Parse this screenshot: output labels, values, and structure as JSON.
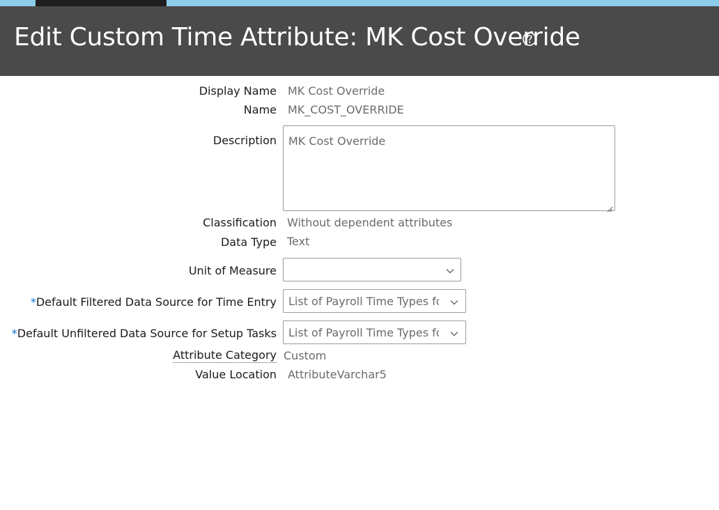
{
  "header": {
    "title": "Edit Custom Time Attribute: MK Cost Override"
  },
  "icons": {
    "help": "help-circle-icon",
    "dropdown": "chevron-down-icon"
  },
  "colors": {
    "header_bg": "#4a4a4a",
    "top_strip": "#8ccbe9",
    "required_asterisk": "#0572ce"
  },
  "form": {
    "display_name": {
      "label": "Display Name",
      "value": "MK Cost Override"
    },
    "name": {
      "label": "Name",
      "value": "MK_COST_OVERRIDE"
    },
    "description": {
      "label": "Description",
      "value": "MK Cost Override"
    },
    "classification": {
      "label": "Classification",
      "value": "Without dependent attributes"
    },
    "data_type": {
      "label": "Data Type",
      "value": "Text"
    },
    "unit_of_measure": {
      "label": "Unit of Measure",
      "value": ""
    },
    "default_filtered": {
      "required_mark": "*",
      "label": "Default Filtered Data Source for Time Entry",
      "value": "List of Payroll Time Types fo"
    },
    "default_unfiltered": {
      "required_mark": "*",
      "label": "Default Unfiltered Data Source for Setup Tasks",
      "value": "List of Payroll Time Types fo"
    },
    "attribute_category": {
      "label": "Attribute Category",
      "value": "Custom"
    },
    "value_location": {
      "label": "Value Location",
      "value": "AttributeVarchar5"
    }
  }
}
